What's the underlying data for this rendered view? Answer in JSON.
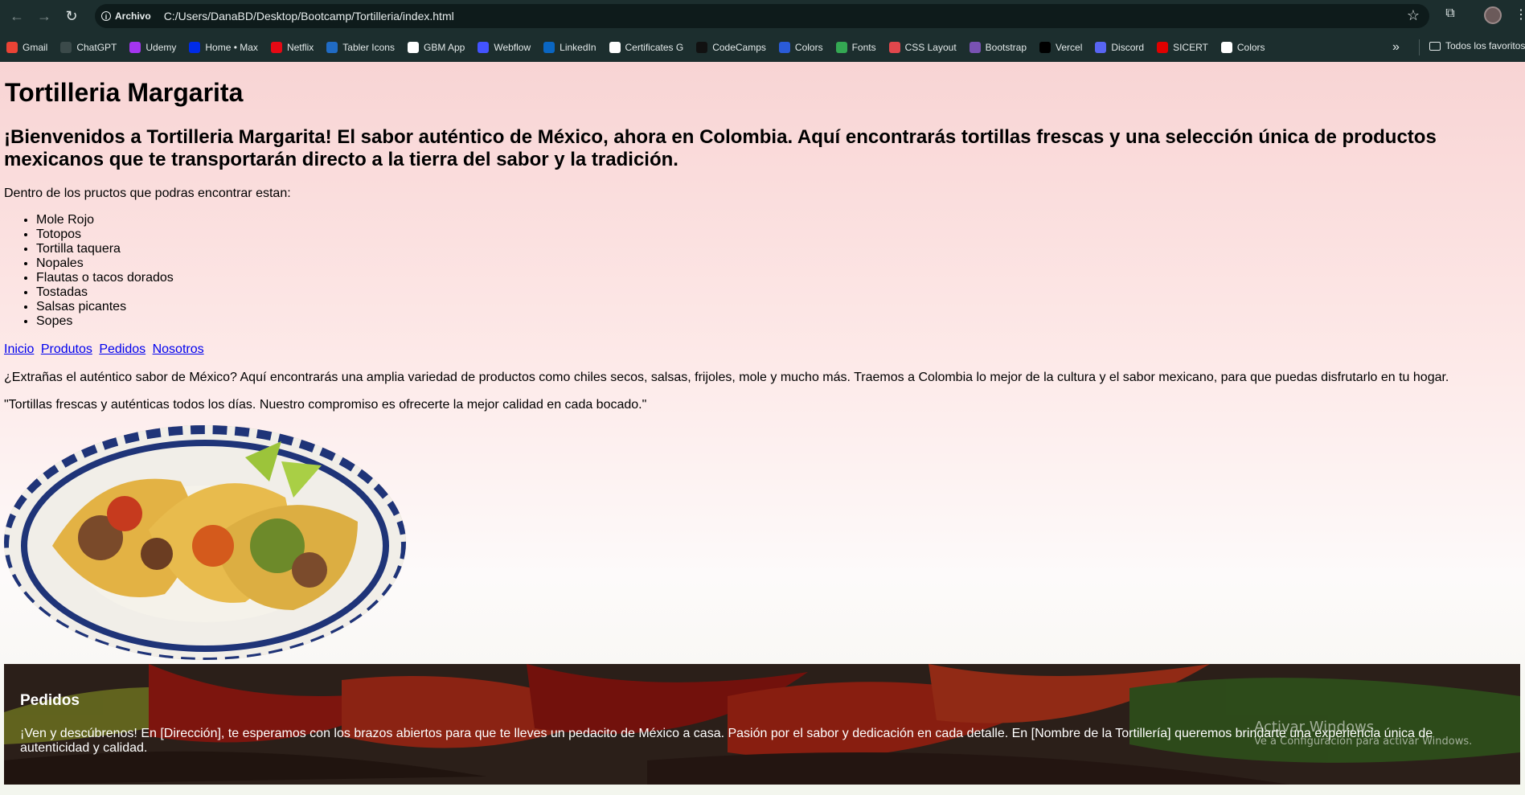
{
  "browser": {
    "chip_label": "Archivo",
    "url": "C:/Users/DanaBD/Desktop/Bootcamp/Tortilleria/index.html",
    "bookmarks": [
      {
        "label": "Gmail",
        "icon": "gmail-icon",
        "color": "#ea4335"
      },
      {
        "label": "ChatGPT",
        "icon": "chatgpt-icon",
        "color": "#3b4a4a"
      },
      {
        "label": "Udemy",
        "icon": "udemy-icon",
        "color": "#a435f0"
      },
      {
        "label": "Home • Max",
        "icon": "max-icon",
        "color": "#002be7"
      },
      {
        "label": "Netflix",
        "icon": "netflix-icon",
        "color": "#e50914"
      },
      {
        "label": "Tabler Icons",
        "icon": "tabler-icon",
        "color": "#206bc4"
      },
      {
        "label": "GBM App",
        "icon": "gbm-icon",
        "color": "#ffffff"
      },
      {
        "label": "Webflow",
        "icon": "webflow-icon",
        "color": "#4353ff"
      },
      {
        "label": "LinkedIn",
        "icon": "linkedin-icon",
        "color": "#0a66c2"
      },
      {
        "label": "Certificates G",
        "icon": "google-icon",
        "color": "#ffffff"
      },
      {
        "label": "CodeCamps",
        "icon": "codecamps-icon",
        "color": "#111111"
      },
      {
        "label": "Colors",
        "icon": "colors-icon",
        "color": "#2a5bd7"
      },
      {
        "label": "Fonts",
        "icon": "fonts-icon",
        "color": "#34a853"
      },
      {
        "label": "CSS Layout",
        "icon": "css-layout-icon",
        "color": "#e0474c"
      },
      {
        "label": "Bootstrap",
        "icon": "bootstrap-icon",
        "color": "#7952b3"
      },
      {
        "label": "Vercel",
        "icon": "vercel-icon",
        "color": "#000000"
      },
      {
        "label": "Discord",
        "icon": "discord-icon",
        "color": "#5865f2"
      },
      {
        "label": "SICERT",
        "icon": "sicert-icon",
        "color": "#e00000"
      },
      {
        "label": "Colors",
        "icon": "google-colors-icon",
        "color": "#ffffff"
      }
    ],
    "bookmarks_more": "»",
    "all_bookmarks_label": "Todos los favoritos"
  },
  "page": {
    "title": "Tortilleria Margarita",
    "subtitle": "¡Bienvenidos a Tortilleria Margarita! El sabor auténtico de México, ahora en Colombia. Aquí encontrarás tortillas frescas y una selección única de productos mexicanos que te transportarán directo a la tierra del sabor y la tradición.",
    "intro": "Dentro de los pructos que podras encontrar estan:",
    "products": [
      "Mole Rojo",
      "Totopos",
      "Tortilla taquera",
      "Nopales",
      "Flautas o tacos dorados",
      "Tostadas",
      "Salsas picantes",
      "Sopes"
    ],
    "nav": [
      "Inicio",
      "Produtos",
      "Pedidos",
      "Nosotros"
    ],
    "paragraph1": "¿Extrañas el auténtico sabor de México? Aquí encontrarás una amplia variedad de productos como chiles secos, salsas, frijoles, mole y mucho más. Traemos a Colombia lo mejor de la cultura y el sabor mexicano, para que puedas disfrutarlo en tu hogar.",
    "paragraph2": "\"Tortillas frescas y auténticas todos los días. Nuestro compromiso es ofrecerte la mejor calidad en cada bocado.\"",
    "pedidos": {
      "heading": "Pedidos",
      "text": "¡Ven y descúbrenos! En [Dirección], te esperamos con los brazos abiertos para que te lleves un pedacito de México a casa. Pasión por el sabor y dedicación en cada detalle. En [Nombre de la Tortillería] queremos brindarte una experiencia única de autenticidad y calidad."
    },
    "link_color": "#0000ee"
  },
  "os_watermark": {
    "line1": "Activar Windows",
    "line2": "Ve a Configuración para activar Windows."
  }
}
